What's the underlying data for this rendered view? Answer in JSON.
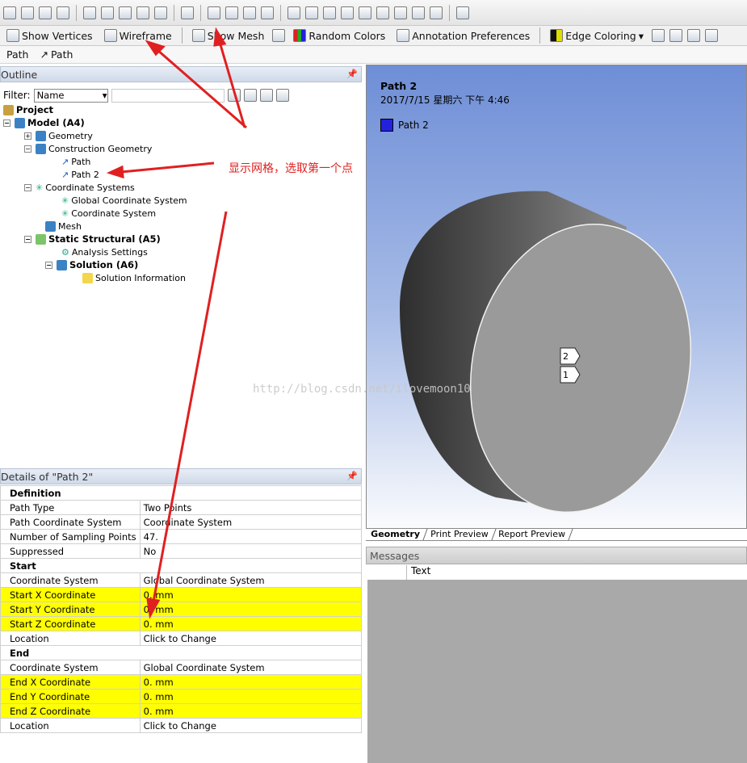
{
  "toolbar2": {
    "show_vertices": "Show Vertices",
    "wireframe": "Wireframe",
    "show_mesh": "Show Mesh",
    "random_colors": "Random Colors",
    "annotation_prefs": "Annotation Preferences",
    "edge_coloring": "Edge Coloring"
  },
  "toolbar3": {
    "path_left": "Path",
    "path_right": "Path"
  },
  "outline": {
    "title": "Outline",
    "filter_label": "Filter:",
    "filter_value": "Name",
    "tree": [
      {
        "label": "Project",
        "bold": true
      },
      {
        "label": "Model (A4)",
        "bold": true
      },
      {
        "label": "Geometry"
      },
      {
        "label": "Construction Geometry"
      },
      {
        "label": "Path"
      },
      {
        "label": "Path 2"
      },
      {
        "label": "Coordinate Systems"
      },
      {
        "label": "Global Coordinate System"
      },
      {
        "label": "Coordinate System"
      },
      {
        "label": "Mesh"
      },
      {
        "label": "Static Structural (A5)",
        "bold": true
      },
      {
        "label": "Analysis Settings"
      },
      {
        "label": "Solution (A6)",
        "bold": true
      },
      {
        "label": "Solution Information"
      }
    ]
  },
  "details": {
    "title": "Details of \"Path 2\"",
    "rows": [
      {
        "section": "Definition"
      },
      {
        "k": "Path Type",
        "v": "Two Points"
      },
      {
        "k": "Path Coordinate System",
        "v": "Coordinate System"
      },
      {
        "k": "Number of Sampling Points",
        "v": "47."
      },
      {
        "k": "Suppressed",
        "v": "No"
      },
      {
        "section": "Start"
      },
      {
        "k": "Coordinate System",
        "v": "Global Coordinate System"
      },
      {
        "k": "Start X Coordinate",
        "v": "0. mm",
        "hl": true
      },
      {
        "k": "Start Y Coordinate",
        "v": "0. mm",
        "hl": true
      },
      {
        "k": "Start Z Coordinate",
        "v": "0. mm",
        "hl": true
      },
      {
        "k": "Location",
        "v": "Click to Change"
      },
      {
        "section": "End"
      },
      {
        "k": "Coordinate System",
        "v": "Global Coordinate System"
      },
      {
        "k": "End X Coordinate",
        "v": "0. mm",
        "hl": true
      },
      {
        "k": "End Y Coordinate",
        "v": "0. mm",
        "hl": true
      },
      {
        "k": "End Z Coordinate",
        "v": "0. mm",
        "hl": true
      },
      {
        "k": "Location",
        "v": "Click to Change"
      }
    ]
  },
  "viewport": {
    "title": "Path 2",
    "datetime": "2017/7/15 星期六 下午 4:46",
    "legend": "Path 2",
    "legend_color": "#2222dd",
    "marker_2": "2",
    "marker_1": "1"
  },
  "tabs": [
    "Geometry",
    "Print Preview",
    "Report Preview"
  ],
  "messages": {
    "title": "Messages",
    "col_text": "Text"
  },
  "annotation": "显示网格，选取第一个点",
  "watermark": "http://blog.csdn.net/ilovemoon10",
  "colors": {
    "highlight": "#ffff00",
    "arrow": "#e02020"
  }
}
